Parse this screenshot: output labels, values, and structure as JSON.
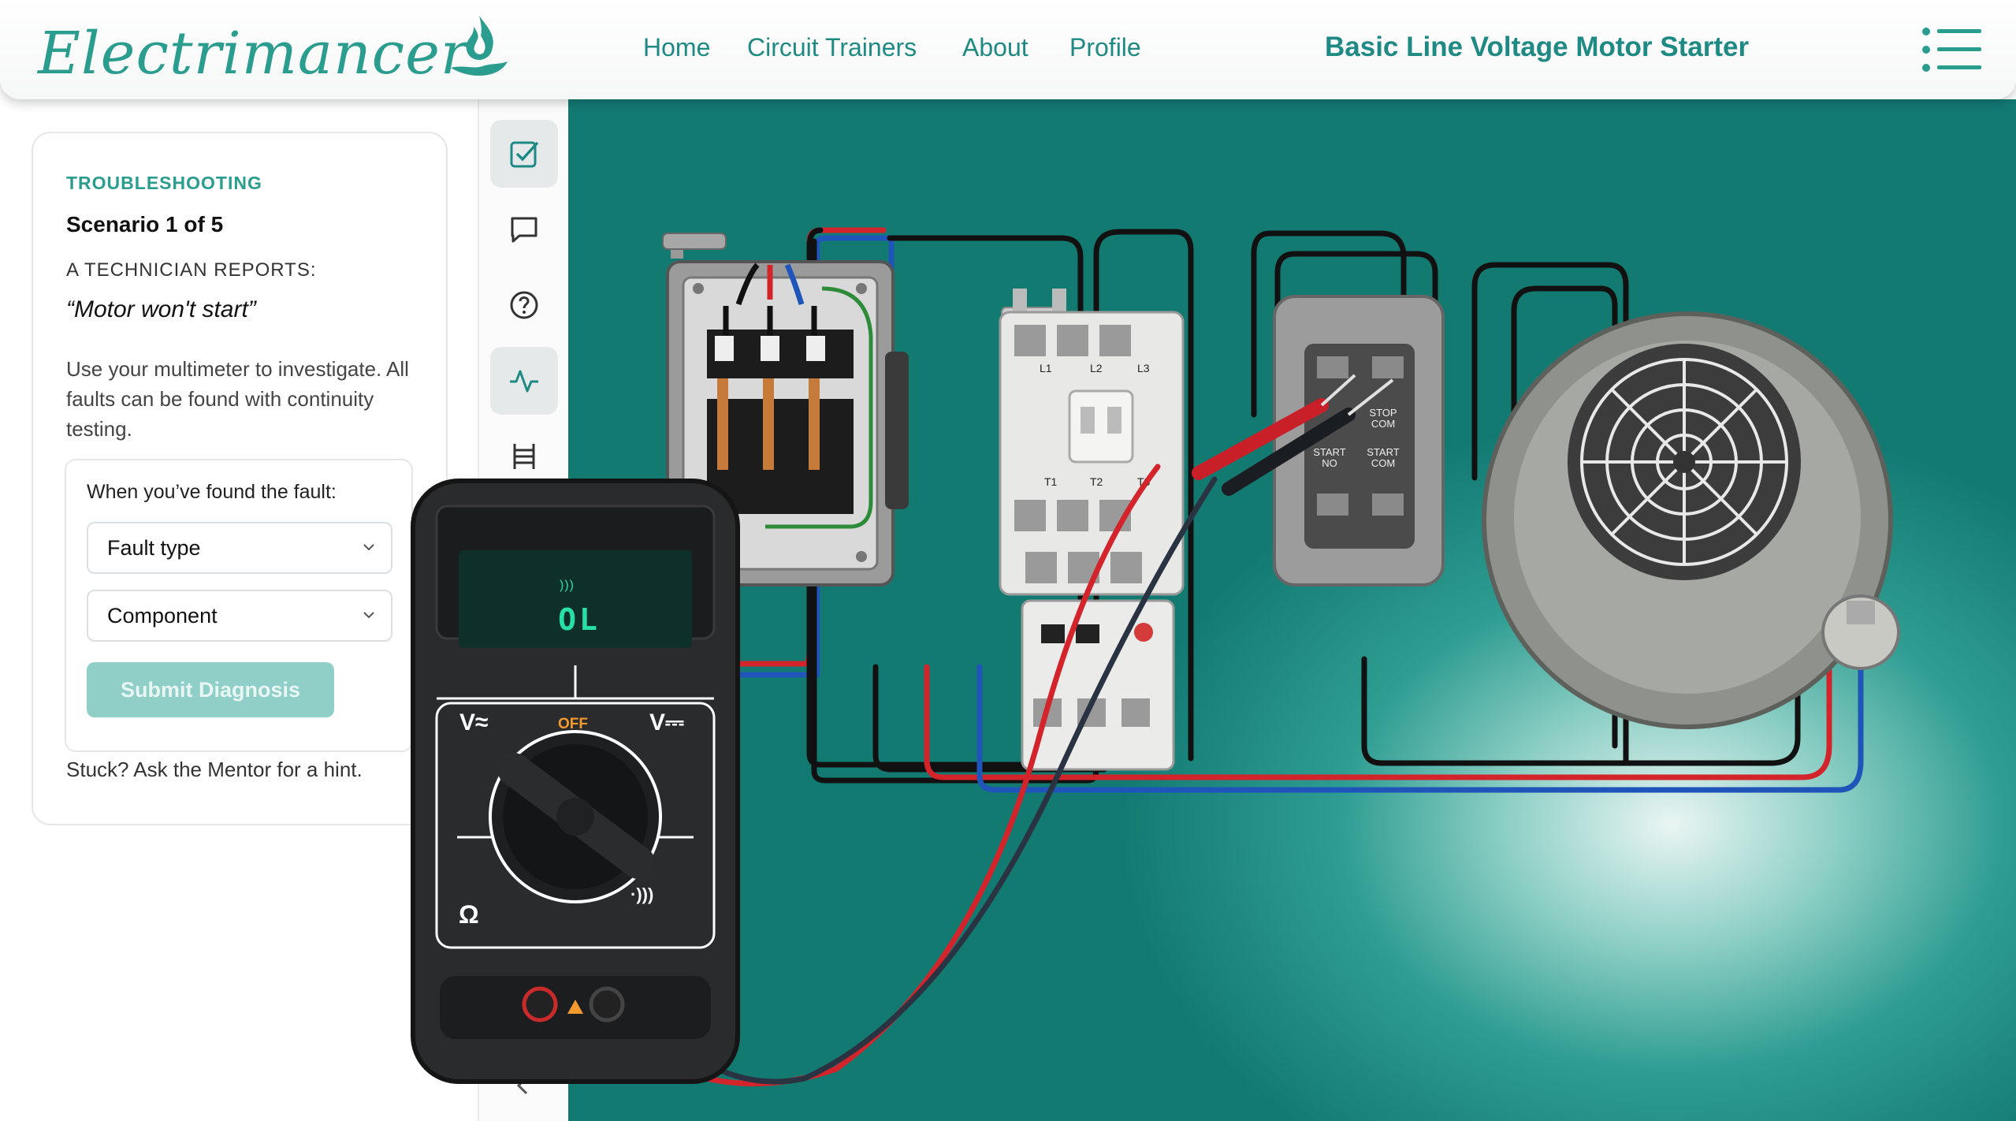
{
  "header": {
    "logo_text": "Electrimancer",
    "nav": [
      {
        "label": "Home"
      },
      {
        "label": "Circuit Trainers"
      },
      {
        "label": "About"
      },
      {
        "label": "Profile"
      }
    ],
    "page_title": "Basic Line Voltage Motor Starter"
  },
  "scenario": {
    "kicker": "TROUBLESHOOTING",
    "title": "Scenario 1 of 5",
    "reports_label": "A TECHNICIAN REPORTS:",
    "quote": "“Motor won't start”",
    "instructions": "Use your multimeter to investigate. All faults can be found with continuity testing.",
    "fault_prompt": "When you’ve found the fault:",
    "fault_type_select": "Fault type",
    "component_select": "Component",
    "submit_label": "Submit Diagnosis",
    "stuck_hint": "Stuck? Ask the Mentor for a hint."
  },
  "tools": [
    {
      "icon": "checklist-icon",
      "active": true
    },
    {
      "icon": "chat-icon",
      "active": false
    },
    {
      "icon": "help-icon",
      "active": false
    },
    {
      "icon": "pulse-icon",
      "active": true
    },
    {
      "icon": "ladder-diagram-icon",
      "active": false
    }
  ],
  "diagram": {
    "contactor_top_terminals": [
      "L1",
      "L2",
      "L3"
    ],
    "contactor_bottom_terminals": [
      "T1",
      "T2",
      "T3"
    ],
    "station_labels": {
      "stop": [
        "STOP",
        "COM"
      ],
      "start_no": [
        "START",
        "NO"
      ],
      "start_com": [
        "START",
        "COM"
      ]
    }
  },
  "multimeter": {
    "reading": "OL",
    "beep_indicator": ")))",
    "dial": {
      "ac_volts": "V≈",
      "off": "OFF",
      "dc_volts": "V⎓",
      "ohms": "Ω",
      "continuity": "·)))"
    }
  },
  "colors": {
    "brand": "#2a9d8f",
    "teal_bg": "#2f9d92",
    "wire_red": "#d4242b",
    "wire_blue": "#1f55b8",
    "wire_black": "#111111",
    "wire_green": "#2e8b3a",
    "display_green": "#27e0a8"
  }
}
